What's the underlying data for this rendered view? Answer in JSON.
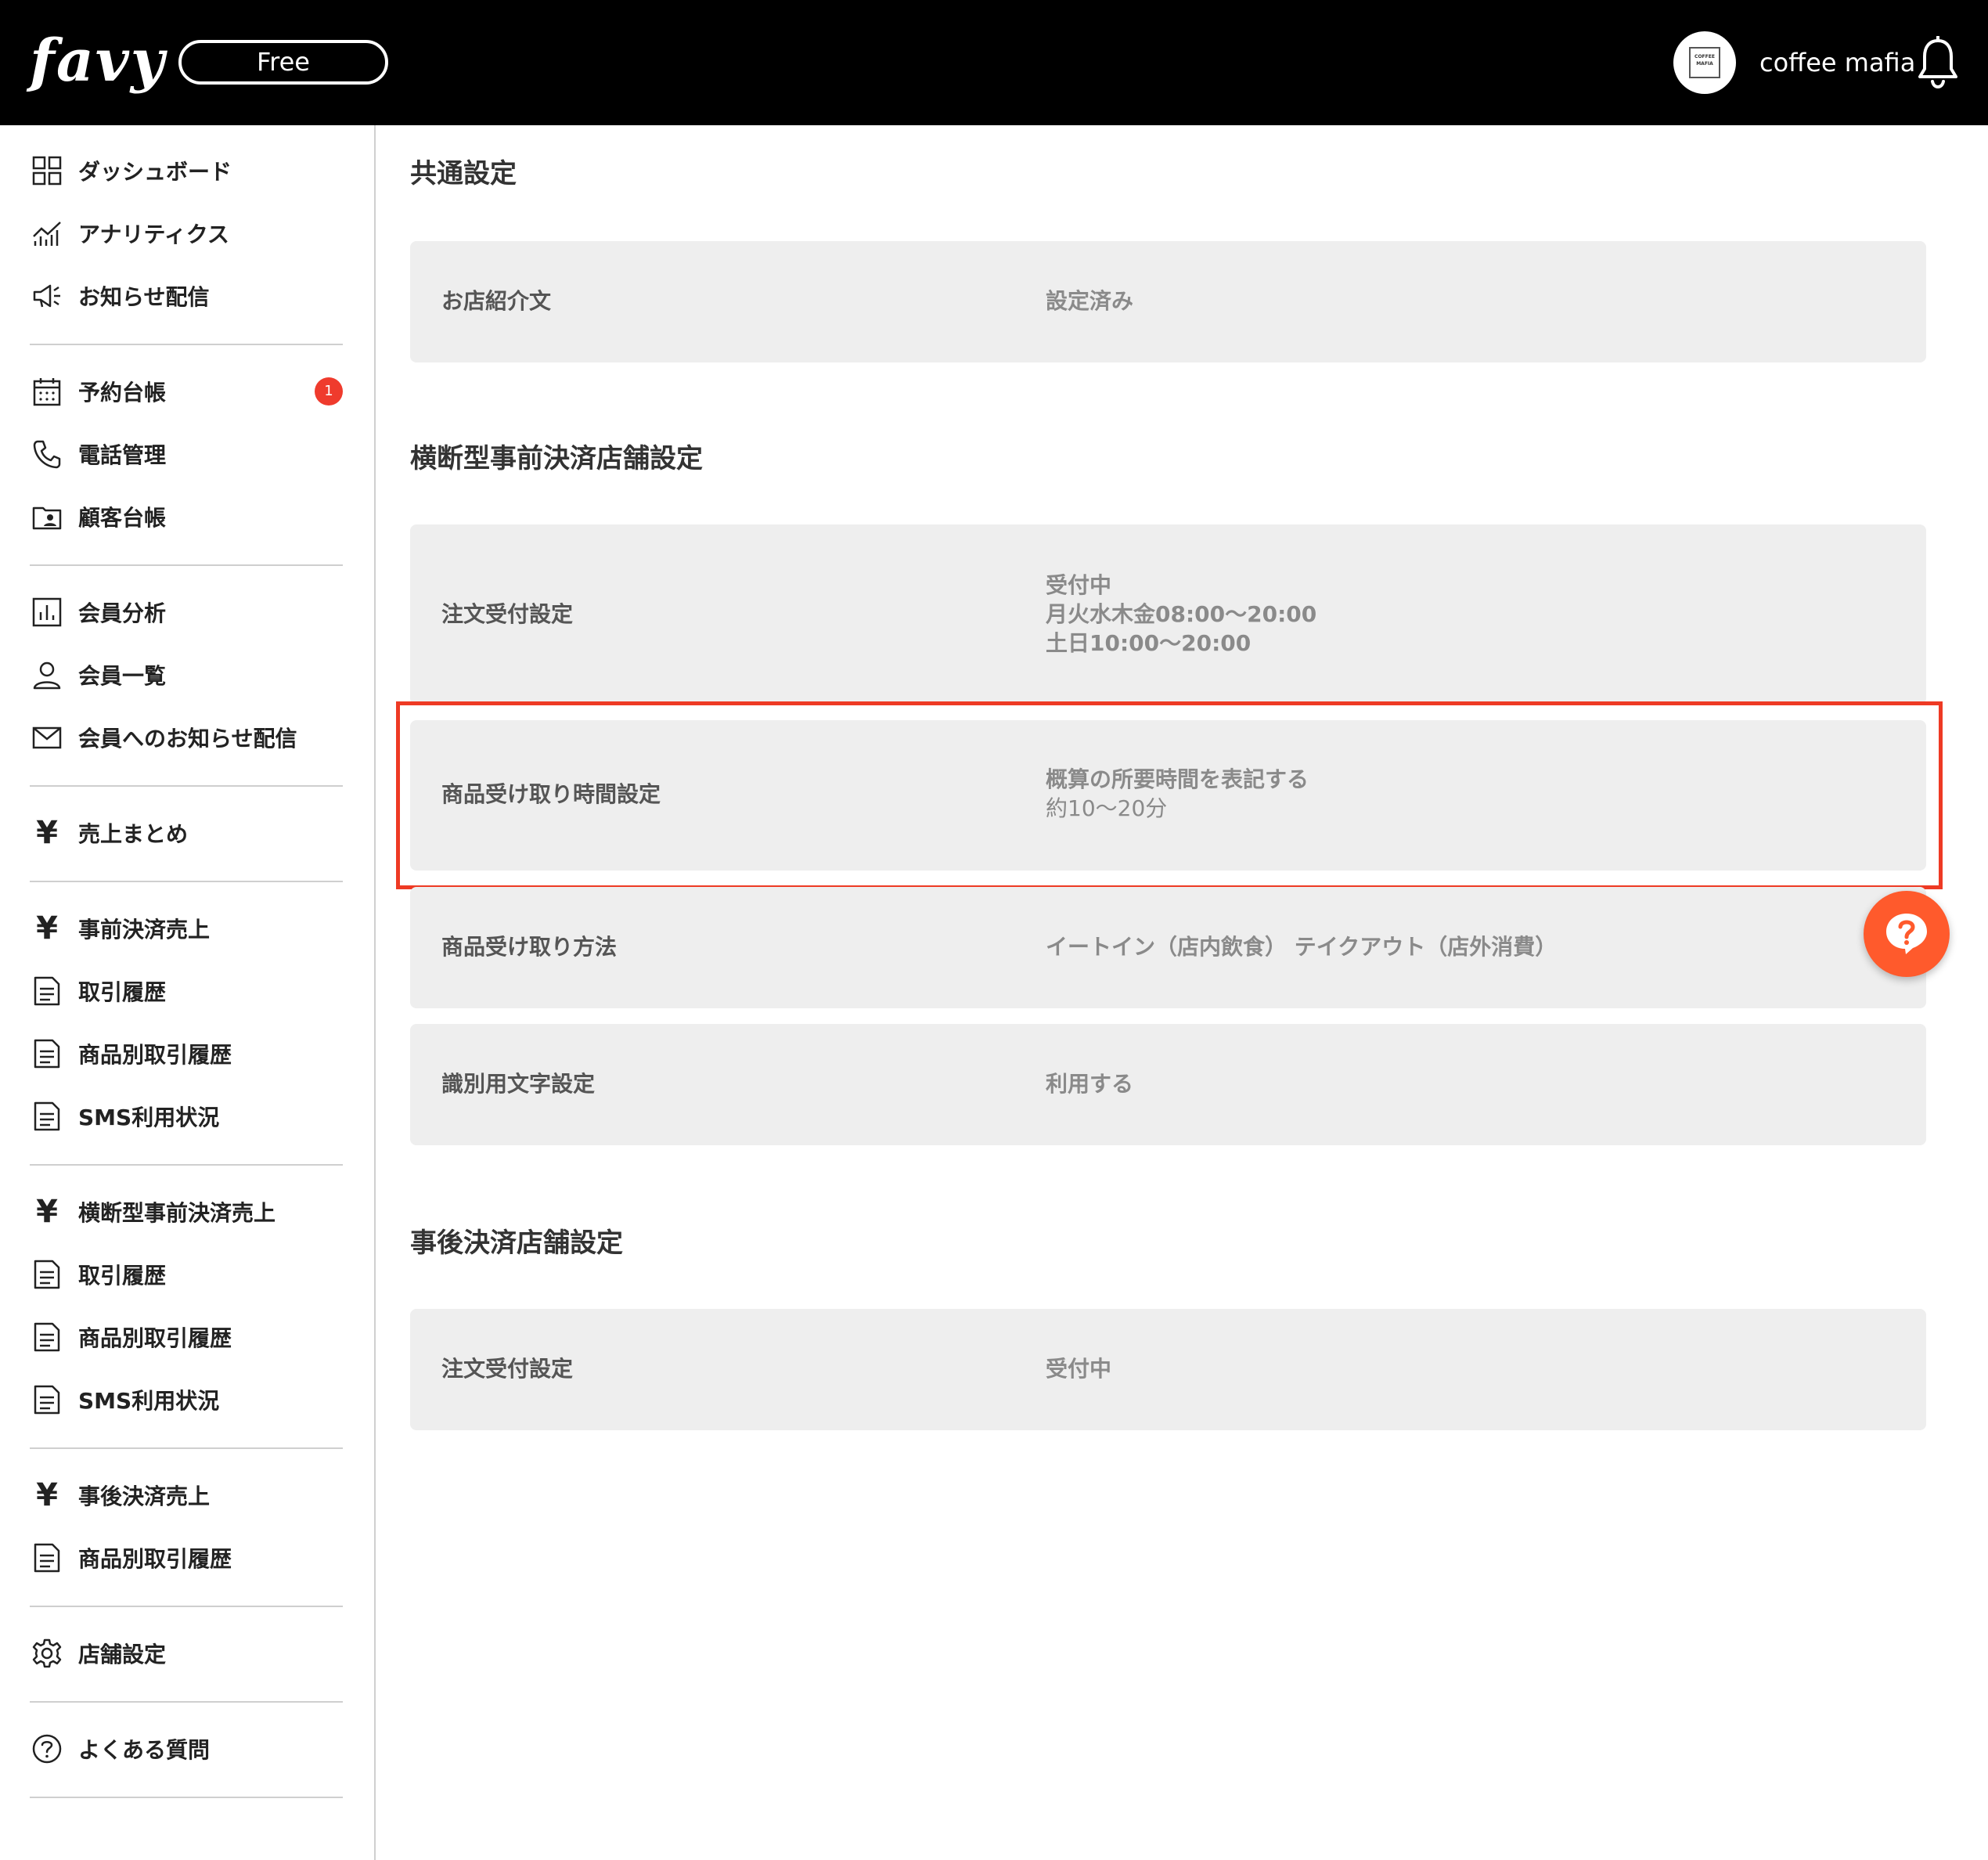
{
  "header": {
    "logo": "favy",
    "plan": "Free",
    "avatar_text": "COFFEE MAFIA",
    "user_name": "coffee mafia"
  },
  "sidebar": {
    "items": [
      {
        "label": "ダッシュボード",
        "icon": "grid-icon"
      },
      {
        "label": "アナリティクス",
        "icon": "analytics-icon"
      },
      {
        "label": "お知らせ配信",
        "icon": "megaphone-icon"
      },
      {
        "label": "予約台帳",
        "icon": "calendar-icon",
        "badge": "1"
      },
      {
        "label": "電話管理",
        "icon": "phone-icon"
      },
      {
        "label": "顧客台帳",
        "icon": "customer-folder-icon"
      },
      {
        "label": "会員分析",
        "icon": "bar-chart-icon"
      },
      {
        "label": "会員一覧",
        "icon": "person-icon"
      },
      {
        "label": "会員へのお知らせ配信",
        "icon": "mail-icon"
      },
      {
        "label": "売上まとめ",
        "icon": "yen-icon"
      },
      {
        "label": "事前決済売上",
        "icon": "yen-icon"
      },
      {
        "label": "取引履歴",
        "icon": "document-icon"
      },
      {
        "label": "商品別取引履歴",
        "icon": "document-icon"
      },
      {
        "label": "SMS利用状況",
        "icon": "document-icon"
      },
      {
        "label": "横断型事前決済売上",
        "icon": "yen-icon"
      },
      {
        "label": "取引履歴",
        "icon": "document-icon"
      },
      {
        "label": "商品別取引履歴",
        "icon": "document-icon"
      },
      {
        "label": "SMS利用状況",
        "icon": "document-icon"
      },
      {
        "label": "事後決済売上",
        "icon": "yen-icon"
      },
      {
        "label": "商品別取引履歴",
        "icon": "document-icon"
      },
      {
        "label": "店舗設定",
        "icon": "gear-icon"
      },
      {
        "label": "よくある質問",
        "icon": "question-circle-icon"
      }
    ]
  },
  "main": {
    "sections": [
      {
        "title": "共通設定",
        "rows": [
          {
            "label": "お店紹介文",
            "value_lines": [
              "設定済み"
            ]
          }
        ]
      },
      {
        "title": "横断型事前決済店舗設定",
        "rows": [
          {
            "label": "注文受付設定",
            "value_lines": [
              "受付中",
              "月火水木金08:00〜20:00",
              "土日10:00〜20:00"
            ]
          },
          {
            "label": "商品受け取り時間設定",
            "value_lines": [
              "概算の所要時間を表記する",
              "約10〜20分"
            ]
          },
          {
            "label": "商品受け取り方法",
            "value_lines": [
              "イートイン（店内飲食） テイクアウト（店外消費）"
            ]
          },
          {
            "label": "識別用文字設定",
            "value_lines": [
              "利用する"
            ]
          }
        ]
      },
      {
        "title": "事後決済店舗設定",
        "rows": [
          {
            "label": "注文受付設定",
            "value_lines": [
              "受付中"
            ]
          }
        ]
      }
    ]
  },
  "colors": {
    "header_bg": "#000000",
    "row_bg": "#eeeeee",
    "highlight": "#ee3a24",
    "badge": "#ef3b2d",
    "help_button": "#ff5a2c"
  }
}
